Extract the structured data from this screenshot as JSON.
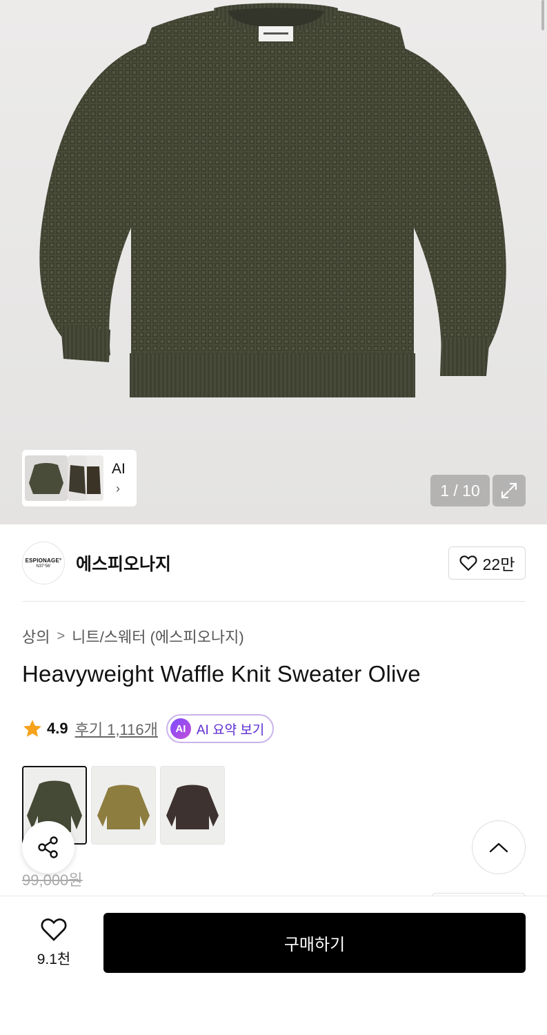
{
  "gallery": {
    "counter": "1 / 10",
    "thumb_ai_label": "AI",
    "thumb_chevron": "›"
  },
  "brand": {
    "logo_line1": "ESPIONAGE°",
    "logo_line2": "N37°56'",
    "name": "에스피오나지",
    "like_count": "22만"
  },
  "breadcrumb": {
    "category": "상의",
    "separator": ">",
    "subcategory": "니트/스웨터 (에스피오나지)"
  },
  "product": {
    "title": "Heavyweight Waffle Knit Sweater Olive",
    "rating": "4.9",
    "reviews": "후기 1,116개",
    "ai_badge": "AI",
    "ai_summary": "AI 요약 보기",
    "original_price": "99,000원",
    "colors": [
      {
        "name": "olive",
        "hex": "#454a36"
      },
      {
        "name": "khaki",
        "hex": "#8d7d3f"
      },
      {
        "name": "brown",
        "hex": "#3e3230"
      }
    ]
  },
  "bottom_bar": {
    "wish_count": "9.1천",
    "buy_label": "구매하기"
  },
  "icons": [
    "heart-icon",
    "expand-icon",
    "star-icon",
    "share-icon",
    "chevron-up-icon"
  ],
  "colors_theme": {
    "star": "#f7a21b",
    "ai_purple": "#5b2bd0",
    "buy_bg": "#000000"
  }
}
